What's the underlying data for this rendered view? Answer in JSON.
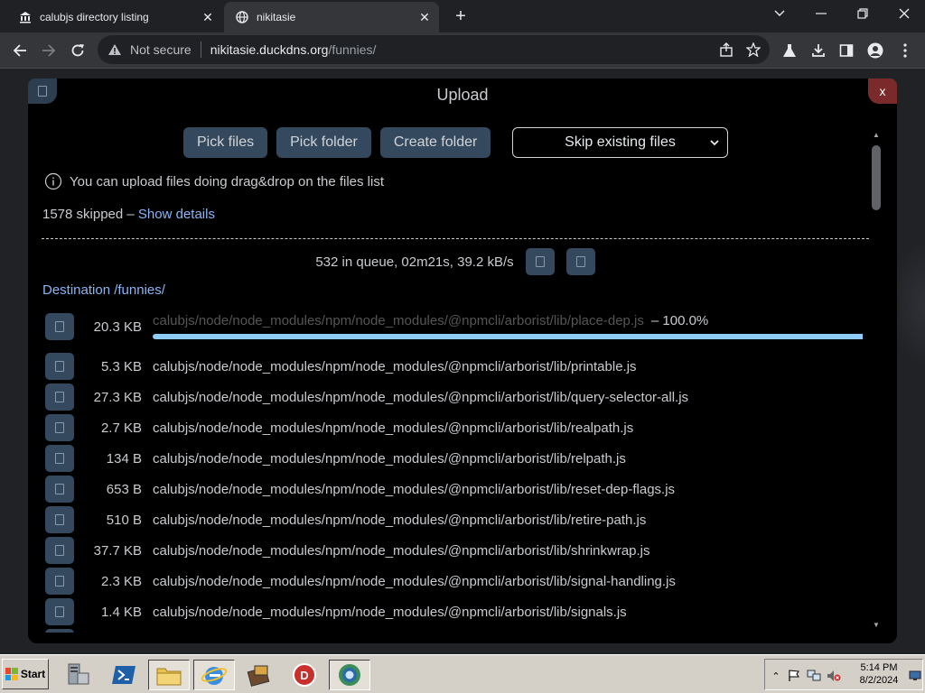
{
  "browser": {
    "tabs": [
      {
        "title": "calubjs directory listing",
        "icon": "bank-icon",
        "active": false
      },
      {
        "title": "nikitasie",
        "icon": "globe-icon",
        "active": true
      }
    ],
    "address": {
      "security_label": "Not secure",
      "host": "nikitasie.duckdns.org",
      "path": "/funnies/"
    }
  },
  "dialog": {
    "title": "Upload",
    "close_label": "x",
    "buttons": {
      "pick_files": "Pick files",
      "pick_folder": "Pick folder",
      "create_folder": "Create folder"
    },
    "existing_mode": "Skip existing files",
    "info_text": "You can upload files doing drag&drop on the files list",
    "skipped_text": "1578 skipped – ",
    "show_details": "Show details",
    "queue_status": "532 in queue, 02m21s, 39.2 kB/s",
    "destination": "Destination /funnies/",
    "current_upload": {
      "size": "20.3 KB",
      "path": "calubjs/node/node_modules/npm/node_modules/@npmcli/arborist/lib/place-dep.js",
      "percent_label": "– 100.0%",
      "progress_fraction": 1.0
    },
    "queue": [
      {
        "size": "5.3 KB",
        "path": "calubjs/node/node_modules/npm/node_modules/@npmcli/arborist/lib/printable.js"
      },
      {
        "size": "27.3 KB",
        "path": "calubjs/node/node_modules/npm/node_modules/@npmcli/arborist/lib/query-selector-all.js"
      },
      {
        "size": "2.7 KB",
        "path": "calubjs/node/node_modules/npm/node_modules/@npmcli/arborist/lib/realpath.js"
      },
      {
        "size": "134 B",
        "path": "calubjs/node/node_modules/npm/node_modules/@npmcli/arborist/lib/relpath.js"
      },
      {
        "size": "653 B",
        "path": "calubjs/node/node_modules/npm/node_modules/@npmcli/arborist/lib/reset-dep-flags.js"
      },
      {
        "size": "510 B",
        "path": "calubjs/node/node_modules/npm/node_modules/@npmcli/arborist/lib/retire-path.js"
      },
      {
        "size": "37.7 KB",
        "path": "calubjs/node/node_modules/npm/node_modules/@npmcli/arborist/lib/shrinkwrap.js"
      },
      {
        "size": "2.3 KB",
        "path": "calubjs/node/node_modules/npm/node_modules/@npmcli/arborist/lib/signal-handling.js"
      },
      {
        "size": "1.4 KB",
        "path": "calubjs/node/node_modules/npm/node_modules/@npmcli/arborist/lib/signals.js"
      },
      {
        "size": "",
        "path": ""
      }
    ]
  },
  "taskbar": {
    "start_label": "Start",
    "clock_time": "5:14 PM",
    "clock_date": "8/2/2024"
  },
  "colors": {
    "dialog_bg": "#000000",
    "button_bg": "#34495e",
    "link": "#8ab4f8",
    "progress_fill": "#8ecdf7"
  }
}
